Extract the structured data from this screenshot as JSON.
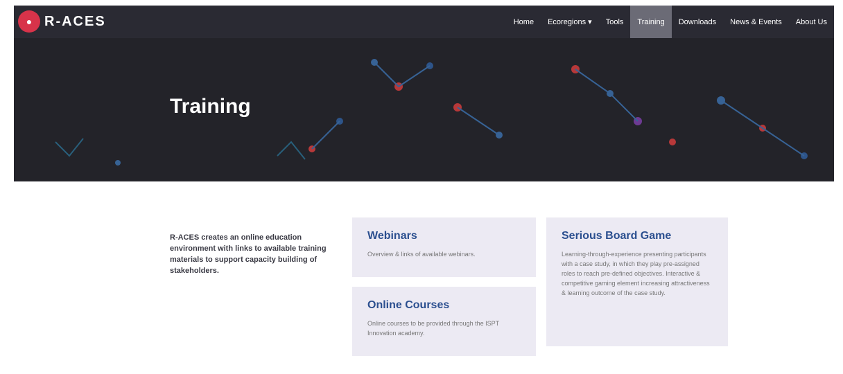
{
  "logo": {
    "text": "R-ACES"
  },
  "nav": {
    "items": [
      {
        "label": "Home"
      },
      {
        "label": "Ecoregions ▾"
      },
      {
        "label": "Tools"
      },
      {
        "label": "Training",
        "active": true
      },
      {
        "label": "Downloads"
      },
      {
        "label": "News & Events"
      },
      {
        "label": "About Us"
      }
    ]
  },
  "hero": {
    "title": "Training"
  },
  "intro": {
    "text": "R-ACES creates an online education environment with links to available training materials to support capacity building of stakeholders."
  },
  "cards": {
    "webinars": {
      "title": "Webinars",
      "text": "Overview & links of available webinars."
    },
    "online_courses": {
      "title": "Online Courses",
      "text": "Online courses to be provided through the ISPT Innovation academy."
    },
    "board_game": {
      "title": "Serious Board Game",
      "text": "Learning-through-experience presenting participants with a case study, in which they play pre-assigned roles to reach pre-defined objectives. Interactive & competitive gaming element increasing attractiveness & learning outcome of the case study."
    }
  },
  "colors": {
    "nav_bg": "#2a2a33",
    "active_bg": "#6b6b76",
    "accent": "#2b4f8f",
    "card_bg": "#eceaf3"
  }
}
